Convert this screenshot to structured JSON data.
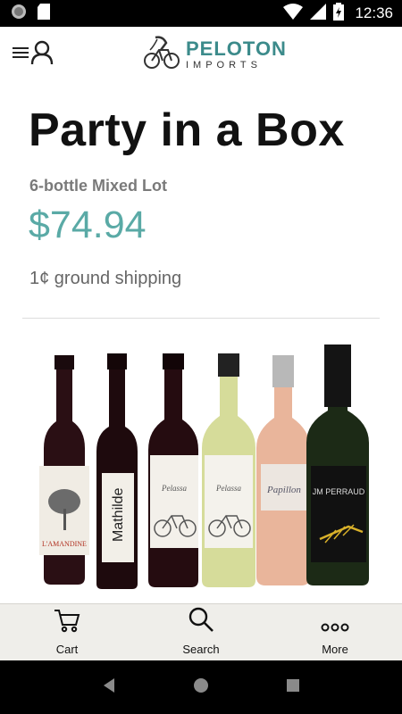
{
  "status_bar": {
    "time": "12:36"
  },
  "header": {
    "logo_title": "PELOTON",
    "logo_subtitle": "IMPORTS"
  },
  "product": {
    "title": "Party in a Box",
    "subtitle": "6-bottle Mixed Lot",
    "price": "$74.94",
    "shipping": "1¢ ground shipping",
    "bottle_labels": [
      "L'AMANDINE",
      "Mathilde",
      "Pelassa",
      "Pelassa",
      "Papillon",
      "JM PERRAUD"
    ]
  },
  "bottom_nav": {
    "items": [
      {
        "label": "Cart",
        "icon": "cart-icon"
      },
      {
        "label": "Search",
        "icon": "search-icon"
      },
      {
        "label": "More",
        "icon": "more-icon"
      }
    ]
  },
  "colors": {
    "accent": "#5aaaa6",
    "logo": "#3c8b8b",
    "nav_bg": "#efeeea"
  }
}
